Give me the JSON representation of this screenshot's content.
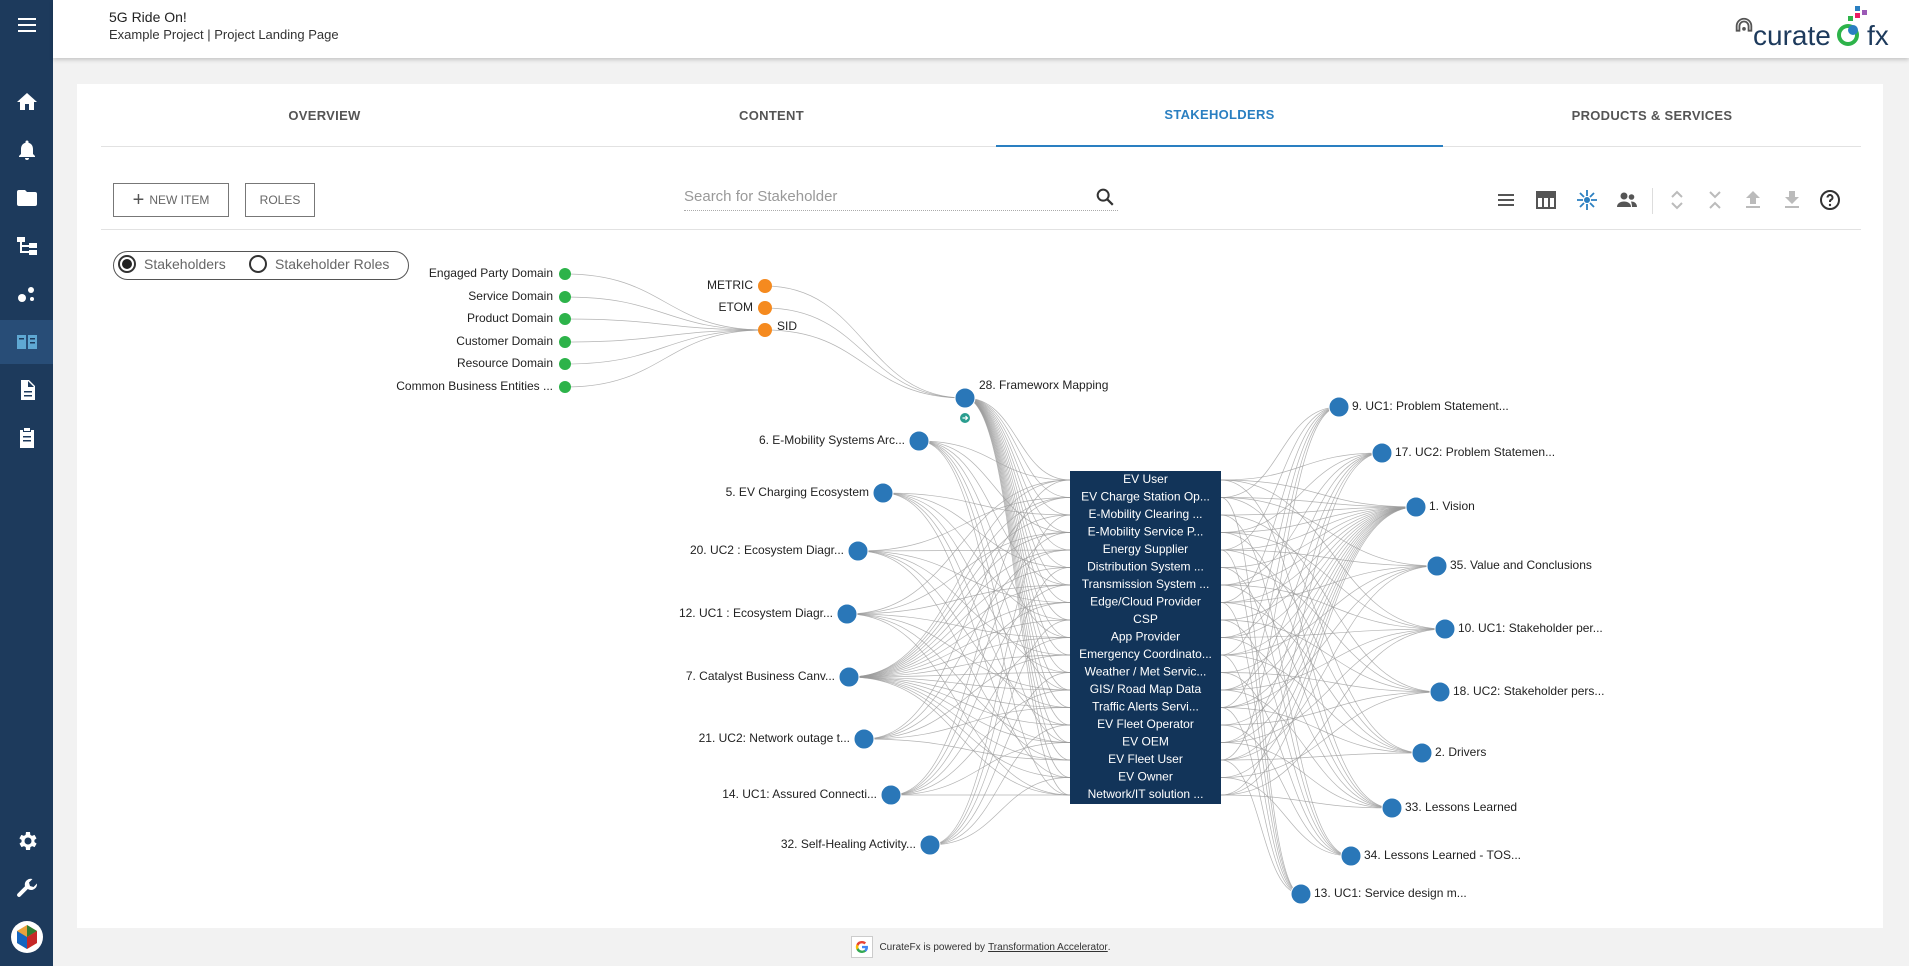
{
  "header": {
    "title": "5G Ride On!",
    "subtitle": "Example Project | Project Landing Page",
    "logo_text": "curate fx"
  },
  "sidebar": {
    "items": [
      {
        "name": "menu-icon"
      },
      {
        "name": "home-icon"
      },
      {
        "name": "bell-icon"
      },
      {
        "name": "folder-icon"
      },
      {
        "name": "hierarchy-icon"
      },
      {
        "name": "network-icon"
      },
      {
        "name": "book-icon"
      },
      {
        "name": "document-icon"
      },
      {
        "name": "clipboard-icon"
      },
      {
        "name": "gear-icon"
      },
      {
        "name": "wrench-icon"
      },
      {
        "name": "app-logo-icon"
      }
    ]
  },
  "tabs": [
    {
      "label": "OVERVIEW",
      "active": false
    },
    {
      "label": "CONTENT",
      "active": false
    },
    {
      "label": "STAKEHOLDERS",
      "active": true
    },
    {
      "label": "PRODUCTS & SERVICES",
      "active": false
    }
  ],
  "toolbar": {
    "new_item_label": "NEW ITEM",
    "roles_label": "ROLES"
  },
  "search": {
    "placeholder": "Search for Stakeholder"
  },
  "view_toggle": {
    "option1": "Stakeholders",
    "option2": "Stakeholder Roles",
    "selected": "Stakeholders"
  },
  "colors": {
    "sidebar": "#1d3a5c",
    "accent": "#2a7fc1",
    "node_blue": "#2a77b8",
    "node_green": "#2db34a",
    "node_orange": "#f58a1f",
    "center_box": "#123459"
  },
  "graph": {
    "domains": [
      "Engaged Party Domain",
      "Service Domain",
      "Product Domain",
      "Customer Domain",
      "Resource Domain",
      "Common Business Entities ..."
    ],
    "frameworks": [
      "METRIC",
      "ETOM",
      "SID"
    ],
    "mapping": "28. Frameworx Mapping",
    "left_nodes": [
      "6. E-Mobility Systems Arc...",
      "5. EV Charging Ecosystem",
      "20. UC2 : Ecosystem Diagr...",
      "12. UC1 : Ecosystem Diagr...",
      "7. Catalyst Business Canv...",
      "21. UC2: Network outage t...",
      "14. UC1: Assured Connecti...",
      "32. Self-Healing Activity..."
    ],
    "stakeholders": [
      "EV User",
      "EV Charge Station Op...",
      "E-Mobility Clearing ...",
      "E-Mobility Service P...",
      "Energy Supplier",
      "Distribution System ...",
      "Transmission System ...",
      "Edge/Cloud Provider",
      "CSP",
      "App Provider",
      "Emergency Coordinato...",
      "Weather / Met Servic...",
      "GIS/ Road Map Data",
      "Traffic Alerts Servi...",
      "EV Fleet Operator",
      "EV OEM",
      "EV Fleet User",
      "EV Owner",
      "Network/IT solution ..."
    ],
    "right_nodes": [
      "9. UC1: Problem Statement...",
      "17. UC2: Problem Statemen...",
      "1. Vision",
      "35. Value and Conclusions",
      "10. UC1: Stakeholder per...",
      "18. UC2: Stakeholder pers...",
      "2. Drivers",
      "33. Lessons Learned",
      "34. Lessons Learned - TOS...",
      "13. UC1: Service design m..."
    ]
  },
  "footer": {
    "text": "CurateFx is powered by",
    "link": "Transformation Accelerator",
    "end": "."
  }
}
